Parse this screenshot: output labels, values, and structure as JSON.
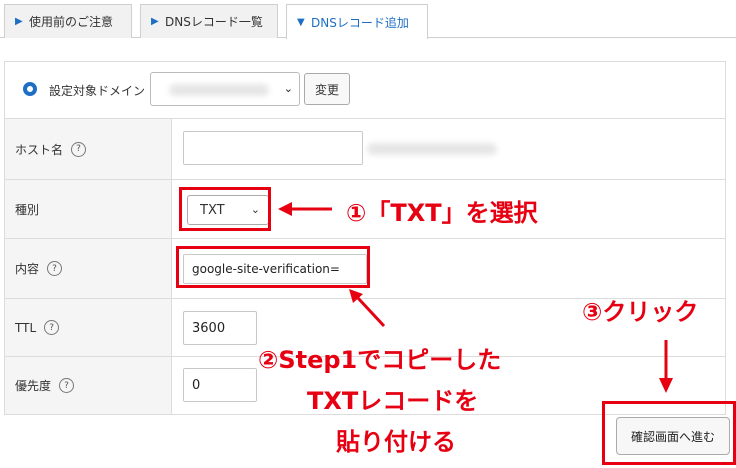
{
  "tabs": [
    {
      "label": "使用前のご注意",
      "active": false
    },
    {
      "label": "DNSレコード一覧",
      "active": false
    },
    {
      "label": "DNSレコード追加",
      "active": true
    }
  ],
  "domain": {
    "label": "設定対象ドメイン",
    "change_button": "変更"
  },
  "fields": {
    "host": {
      "label": "ホスト名",
      "value": ""
    },
    "type": {
      "label": "種別",
      "value": "TXT"
    },
    "content": {
      "label": "内容",
      "value": "google-site-verification="
    },
    "ttl": {
      "label": "TTL",
      "value": "3600"
    },
    "priority": {
      "label": "優先度",
      "value": "0"
    }
  },
  "help_glyph": "?",
  "confirm_button": "確認画面へ進む",
  "annotations": {
    "step1": "①「TXT」を選択",
    "step2_lines": [
      "②Step1でコピーした",
      "TXTレコードを",
      "貼り付ける"
    ],
    "step3": "③クリック"
  },
  "colors": {
    "accent": "#1e6fc4",
    "annotation": "#e60012"
  }
}
